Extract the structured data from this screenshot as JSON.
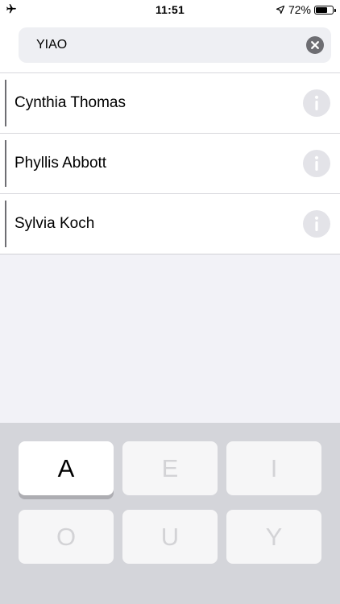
{
  "status_bar": {
    "time": "11:51",
    "battery_percent": "72%",
    "battery_level": 0.72,
    "icons": [
      "airplane-icon",
      "location-arrow-icon",
      "battery-icon"
    ]
  },
  "search": {
    "value": "YIAO",
    "clear_icon": "clear-x-circle-icon"
  },
  "contacts": [
    {
      "name": "Cynthia Thomas",
      "icon": "info-icon"
    },
    {
      "name": "Phyllis Abbott",
      "icon": "info-icon"
    },
    {
      "name": "Sylvia Koch",
      "icon": "info-icon"
    }
  ],
  "keyboard": {
    "keys": [
      {
        "label": "A",
        "state": "active"
      },
      {
        "label": "E",
        "state": "disabled"
      },
      {
        "label": "I",
        "state": "disabled"
      },
      {
        "label": "O",
        "state": "disabled"
      },
      {
        "label": "U",
        "state": "disabled"
      },
      {
        "label": "Y",
        "state": "disabled"
      }
    ]
  },
  "colors": {
    "background": "#f2f2f7",
    "key_active": "#ffffff",
    "key_disabled_text": "#d3d3d6",
    "clear_button": "#6d6d72",
    "info_button": "#e3e3e8"
  }
}
